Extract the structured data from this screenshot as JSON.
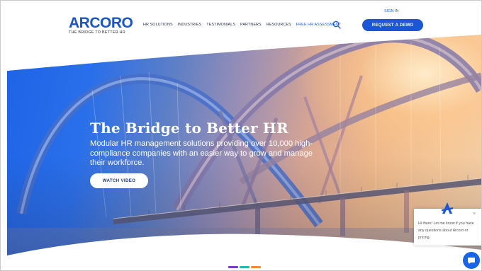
{
  "header": {
    "logo_word": "ARCORO",
    "logo_tagline": "THE BRIDGE TO BETTER HR",
    "nav": [
      {
        "label": "HR SOLUTIONS"
      },
      {
        "label": "INDUSTRIES"
      },
      {
        "label": "TESTIMONIALS"
      },
      {
        "label": "PARTNERS"
      },
      {
        "label": "RESOURCES"
      },
      {
        "label": "FREE HR ASSESSMENT"
      }
    ],
    "search_icon": "search-icon",
    "sign_in": "SIGN IN",
    "demo_button": "REQUEST A DEMO"
  },
  "hero": {
    "title": "The Bridge to Better HR",
    "subtitle": "Modular HR management solutions providing over 10,000 high-compliance companies with an easier way to grow and manage their workforce.",
    "watch_button": "WATCH VIDEO"
  },
  "slider_dots": [
    "#7b3fbf",
    "#2bb6b0",
    "#f08a3c"
  ],
  "chat": {
    "message": "Hi there! Let me know if you have any questions about Arcoro or pricing.",
    "close": "×"
  },
  "colors": {
    "brand_blue": "#1a56d6",
    "nav_text": "#2b2f4a"
  }
}
